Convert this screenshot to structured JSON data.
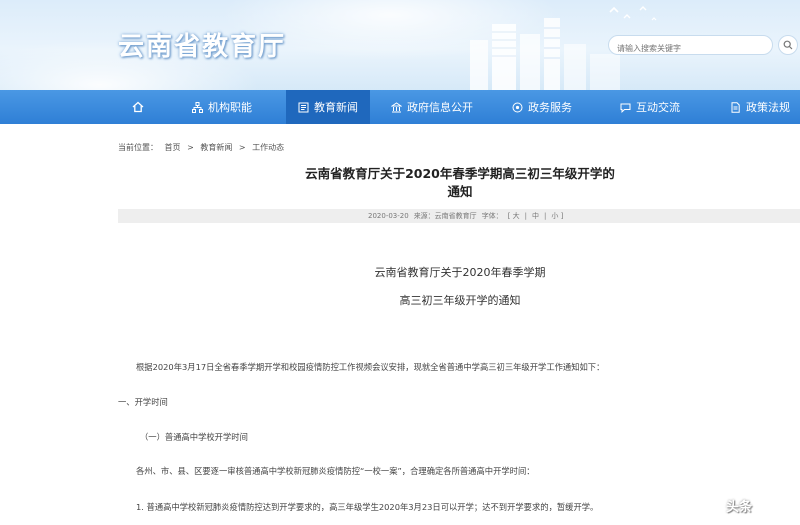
{
  "site": {
    "title": "云南省教育厅"
  },
  "search": {
    "placeholder": "请输入搜索关键字"
  },
  "nav": {
    "items": [
      {
        "label": "",
        "icon": "home-icon"
      },
      {
        "label": "机构职能",
        "icon": "org-chart-icon"
      },
      {
        "label": "教育新闻",
        "icon": "news-icon"
      },
      {
        "label": "政府信息公开",
        "icon": "building-icon"
      },
      {
        "label": "政务服务",
        "icon": "service-icon"
      },
      {
        "label": "互动交流",
        "icon": "chat-icon"
      },
      {
        "label": "政策法规",
        "icon": "document-icon"
      }
    ],
    "active_index": 2
  },
  "breadcrumb": {
    "prefix": "当前位置：",
    "items": [
      "首页",
      "教育新闻",
      "工作动态"
    ],
    "separator": ">"
  },
  "article": {
    "title_line1": "云南省教育厅关于2020年春季学期高三初三年级开学的",
    "title_line2": "通知",
    "date": "2020-03-20",
    "source": "来源：云南省教育厅",
    "font_size_label": "字体：",
    "font_sizes": [
      "[ 大",
      "|",
      "中",
      "|",
      "小 ]"
    ],
    "body_heading_line1": "云南省教育厅关于2020年春季学期",
    "body_heading_line2": "高三初三年级开学的通知",
    "intro": "根据2020年3月17日全省春季学期开学和校园疫情防控工作视频会议安排，现就全省普通中学高三初三年级开学工作通知如下：",
    "section1": "一、开学时间",
    "subsection1": "（一）普通高中学校开学时间",
    "para1": "各州、市、县、区要逐一审核普通高中学校新冠肺炎疫情防控“一校一案”，合理确定各所普通高中开学时间：",
    "para2": "1. 普通高中学校新冠肺炎疫情防控达到开学要求的，高三年级学生2020年3月23日可以开学；达不到开学要求的，暂缓开学。"
  },
  "watermark": {
    "text": "头条"
  },
  "colors": {
    "nav_bg": "#2f7fd6",
    "nav_active": "#1f68bd",
    "header_bg": "#dcecfa"
  }
}
